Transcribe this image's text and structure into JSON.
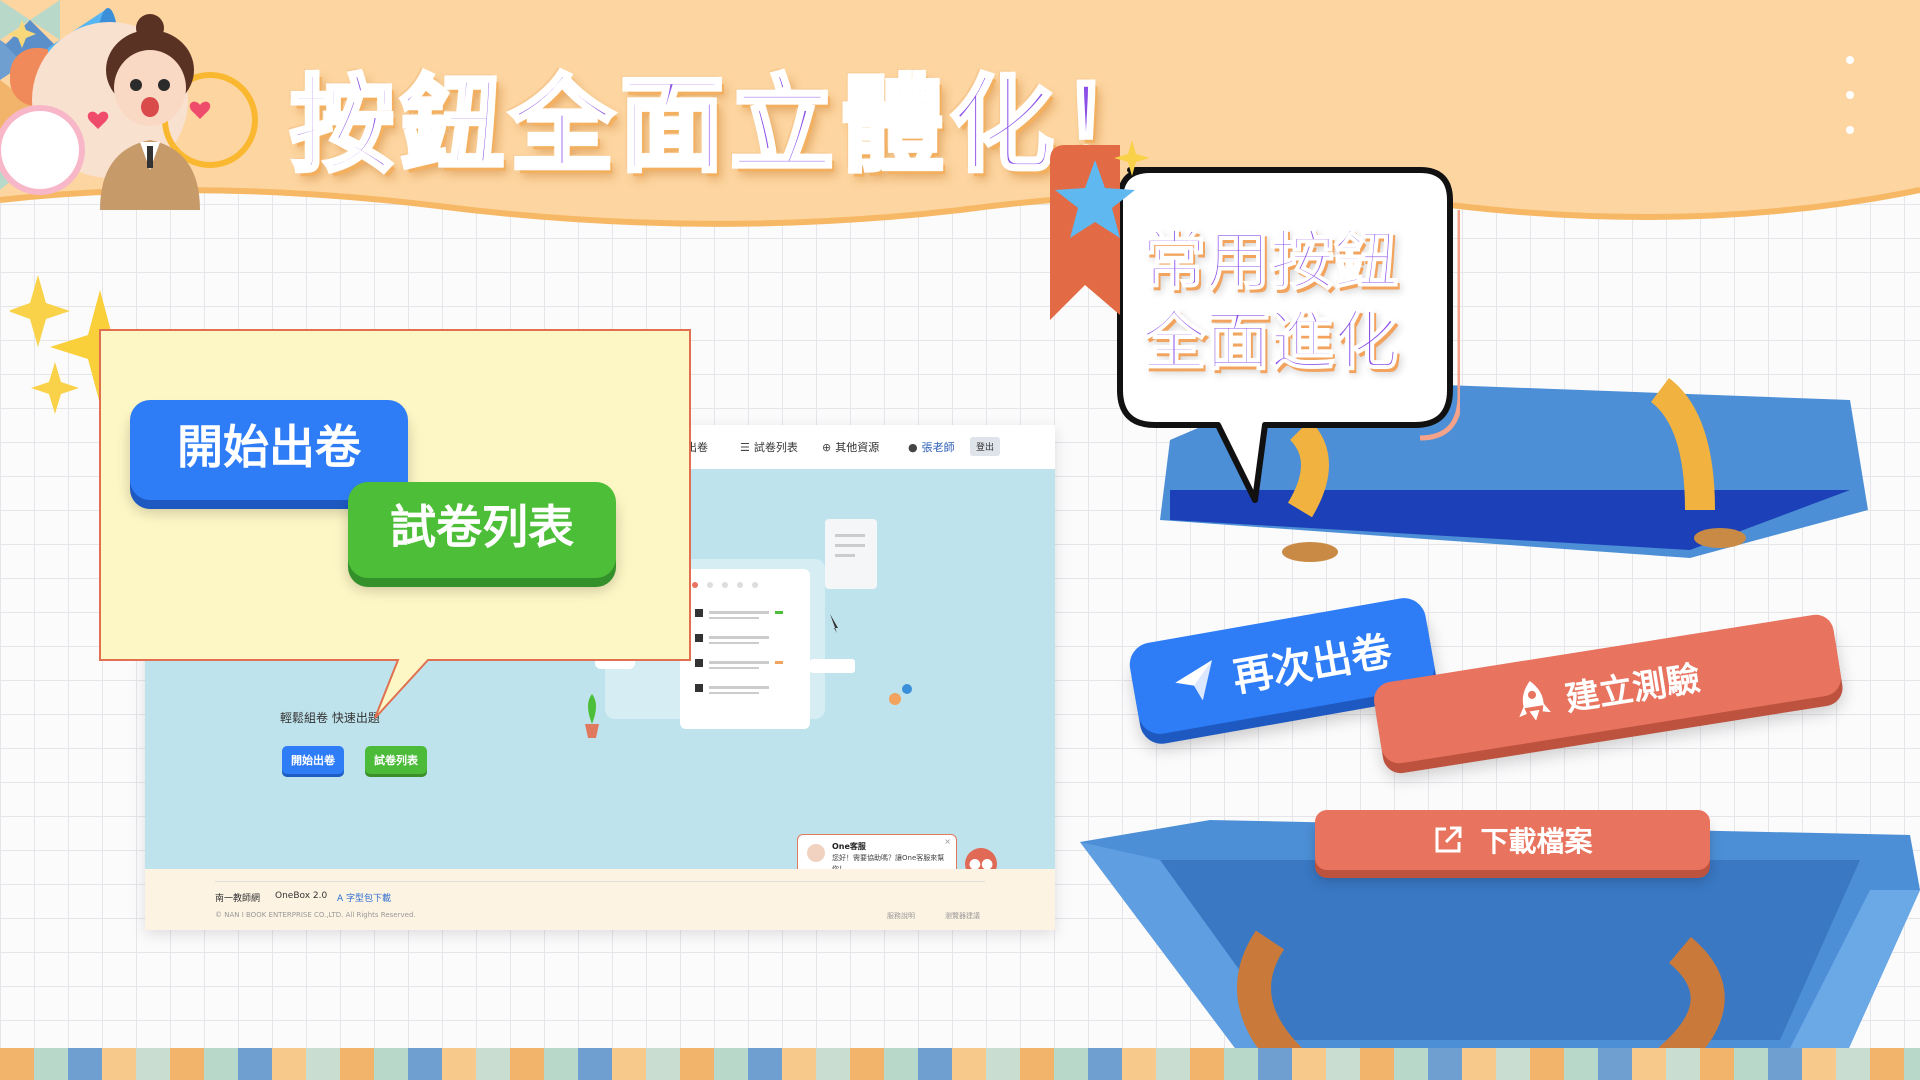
{
  "header": {
    "title": "按鈕全面立體化！"
  },
  "callout": {
    "start_button": "開始出卷",
    "list_button": "試卷列表"
  },
  "site": {
    "nav": {
      "items": [
        "要出卷",
        "試卷列表",
        "其他資源",
        "張老師"
      ],
      "logout": "登出"
    },
    "hero": {
      "subtitle": "輕鬆組卷 快速出題",
      "start_button": "開始出卷",
      "list_button": "試卷列表"
    },
    "chat": {
      "title": "One客服",
      "message": "您好！需要協助嗎？讓One客服來幫你！",
      "close": "×"
    },
    "footer": {
      "items": [
        "南一教師網",
        "OneBox 2.0",
        "字型包下載"
      ],
      "copyright": "© NAN I BOOK ENTERPRISE CO.,LTD. All Rights Reserved.",
      "links": [
        "服務說明",
        "瀏覽器建議"
      ]
    }
  },
  "bubble": {
    "line1": "常用按鈕",
    "line2": "全面進化"
  },
  "buttons3d": {
    "again": "再次出卷",
    "create": "建立測驗",
    "download": "下載檔案"
  },
  "icons": [
    "megaphone-icon",
    "teacher-illustration",
    "star-ribbon-icon",
    "sparkle-icon",
    "send-icon",
    "rocket-icon",
    "external-link-icon",
    "list-icon",
    "plus-circle-icon",
    "user-icon",
    "chat-icon"
  ],
  "colors": {
    "header_bg": "#fdd5a0",
    "title": "#8b4fe8",
    "primary_blue": "#2f7df6",
    "green": "#4cbe37",
    "coral": "#e8735e",
    "callout_bg": "#fdf7c5",
    "hero_bg": "#bfe3ec",
    "box_blue": "#4c8fd6"
  }
}
